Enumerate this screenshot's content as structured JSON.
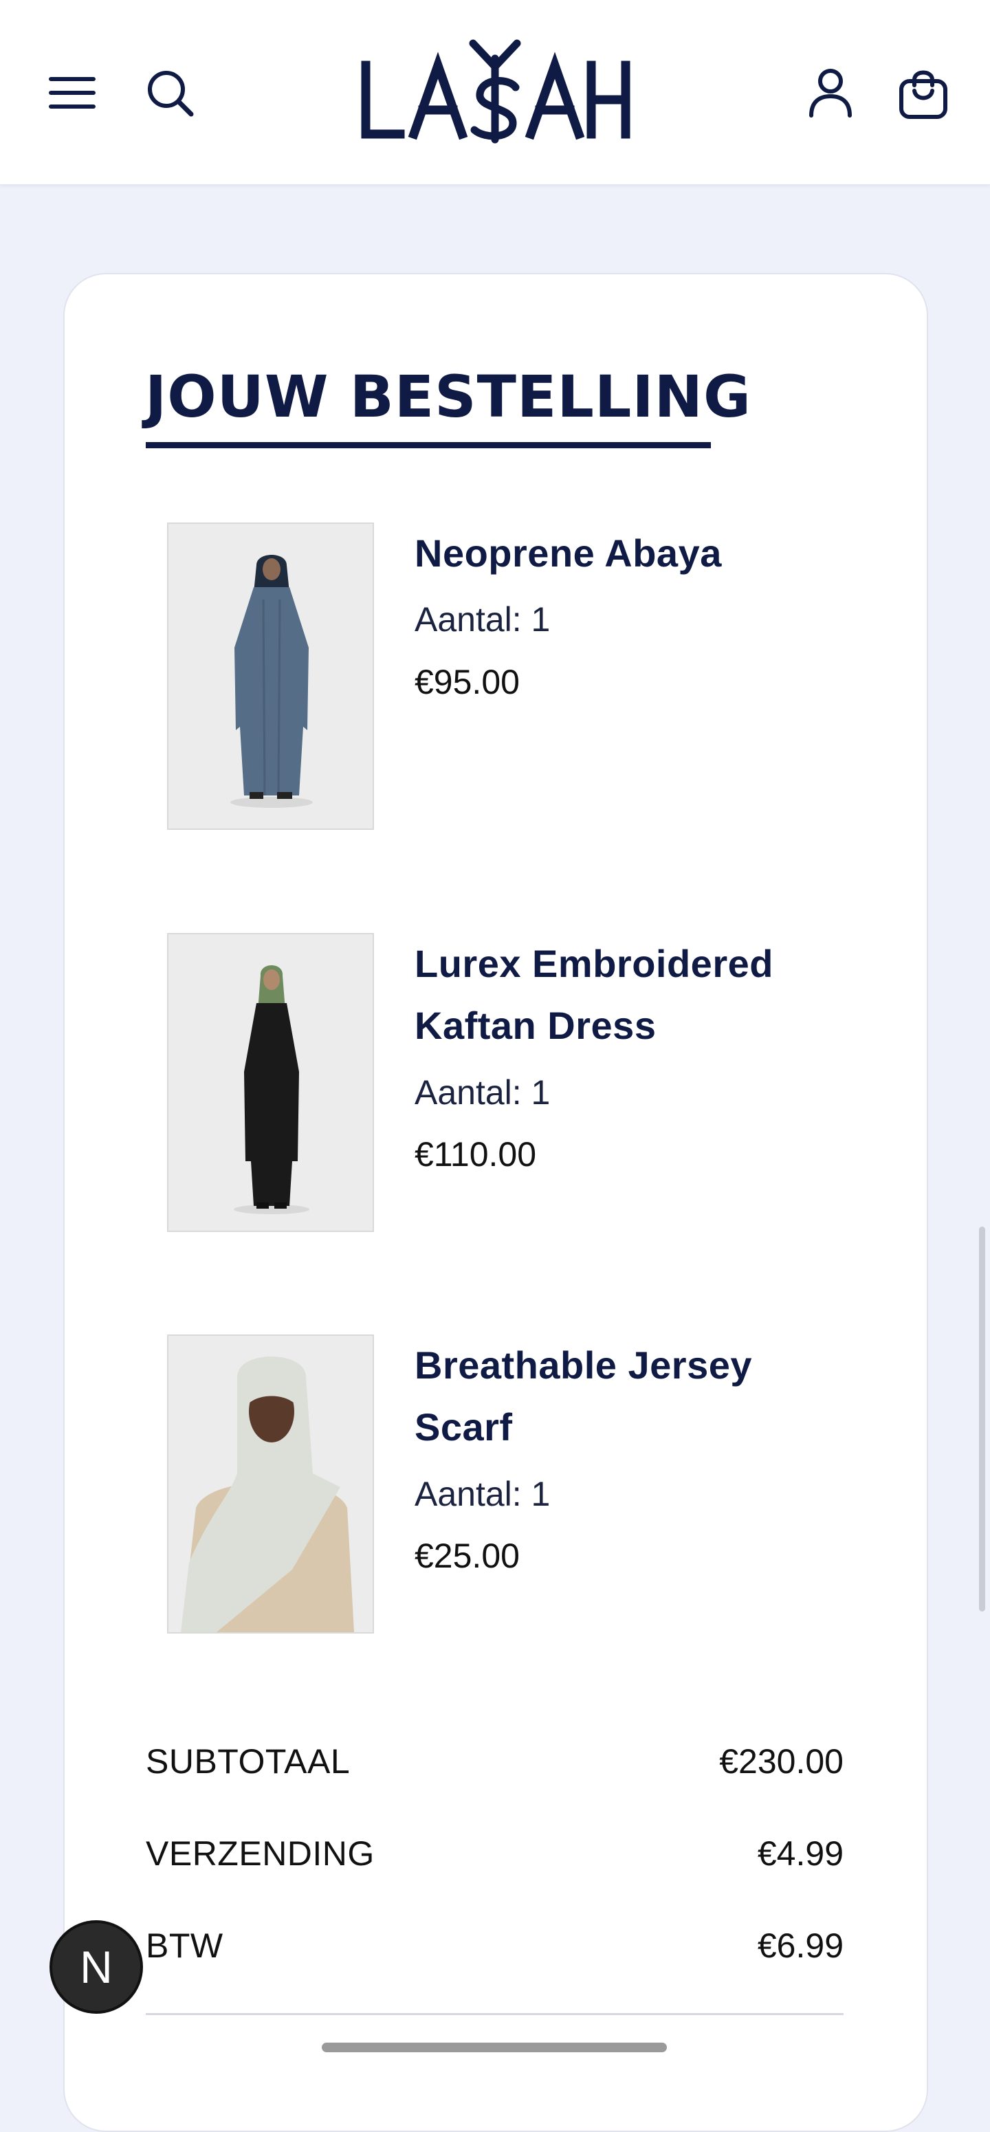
{
  "header": {
    "logo_text": "LASAH",
    "icons": [
      "menu-icon",
      "search-icon",
      "account-icon",
      "cart-icon"
    ]
  },
  "order": {
    "title": "JOUW BESTELLING",
    "items": [
      {
        "name": "Neoprene Abaya",
        "qty": "Aantal: 1",
        "price": "€95.00"
      },
      {
        "name": "Lurex Embroidered Kaftan Dress",
        "qty": "Aantal: 1",
        "price": "€110.00"
      },
      {
        "name": "Breathable Jersey Scarf",
        "qty": "Aantal: 1",
        "price": "€25.00"
      }
    ],
    "summary": {
      "subtotal_label": "SUBTOTAAL",
      "subtotal": "€230.00",
      "shipping_label": "VERZENDING",
      "shipping": "€4.99",
      "vat_label": "BTW",
      "vat": "€6.99"
    }
  },
  "badge": "N",
  "colors": {
    "navy": "#0f1b44",
    "page_bg": "#eef1fa",
    "card_bg": "#ffffff"
  }
}
